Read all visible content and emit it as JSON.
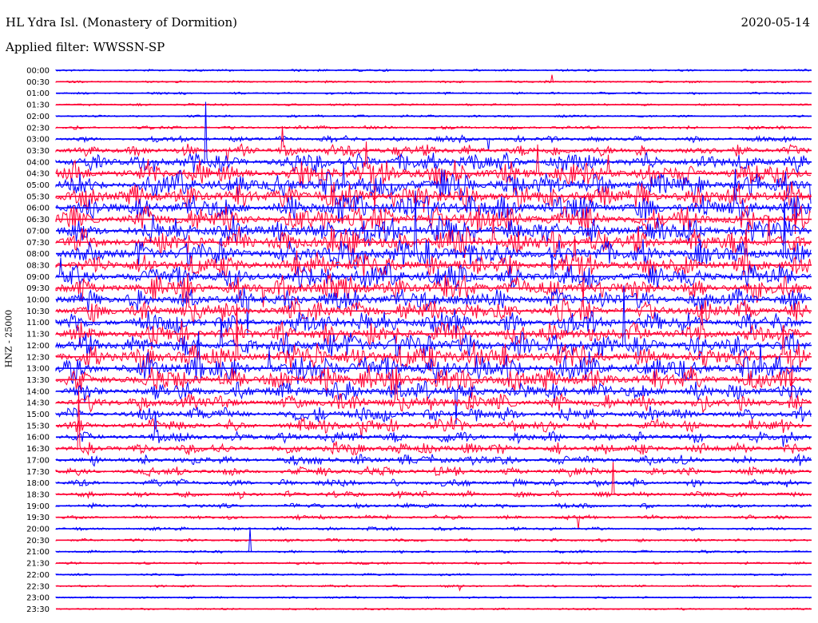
{
  "header": {
    "station": "HL Ydra Isl. (Monastery of Dormition)",
    "date": "2020-05-14",
    "filter": "Applied filter: WWSSN-SP"
  },
  "chart_data": {
    "type": "line",
    "title": "HL Ydra Isl. (Monastery of Dormition)",
    "ylabel": "HNZ - 25000",
    "xlabel": "",
    "trace_times": [
      "00:00",
      "00:30",
      "01:00",
      "01:30",
      "02:00",
      "02:30",
      "03:00",
      "03:30",
      "04:00",
      "04:30",
      "05:00",
      "05:30",
      "06:00",
      "06:30",
      "07:00",
      "07:30",
      "08:00",
      "08:30",
      "09:00",
      "09:30",
      "10:00",
      "10:30",
      "11:00",
      "11:30",
      "12:00",
      "12:30",
      "13:00",
      "13:30",
      "14:00",
      "14:30",
      "15:00",
      "15:30",
      "16:00",
      "16:30",
      "17:00",
      "17:30",
      "18:00",
      "18:30",
      "19:00",
      "19:30",
      "20:00",
      "20:30",
      "21:00",
      "21:30",
      "22:00",
      "22:30",
      "23:00",
      "23:30"
    ],
    "trace_minutes": 30,
    "colors": [
      "#0000ff",
      "#ff0033"
    ],
    "grid": false,
    "legend": "none",
    "activity_note_levels": [
      0.05,
      0.05,
      0.05,
      0.05,
      0.05,
      0.1,
      0.2,
      0.4,
      0.7,
      0.9,
      1.0,
      1.0,
      1.0,
      1.0,
      1.0,
      1.0,
      1.0,
      0.9,
      0.9,
      0.9,
      0.8,
      0.8,
      0.8,
      0.8,
      0.9,
      1.0,
      1.0,
      0.9,
      0.7,
      0.6,
      0.5,
      0.45,
      0.4,
      0.4,
      0.35,
      0.3,
      0.25,
      0.2,
      0.15,
      0.12,
      0.1,
      0.08,
      0.07,
      0.06,
      0.05,
      0.05,
      0.04,
      0.04
    ]
  }
}
